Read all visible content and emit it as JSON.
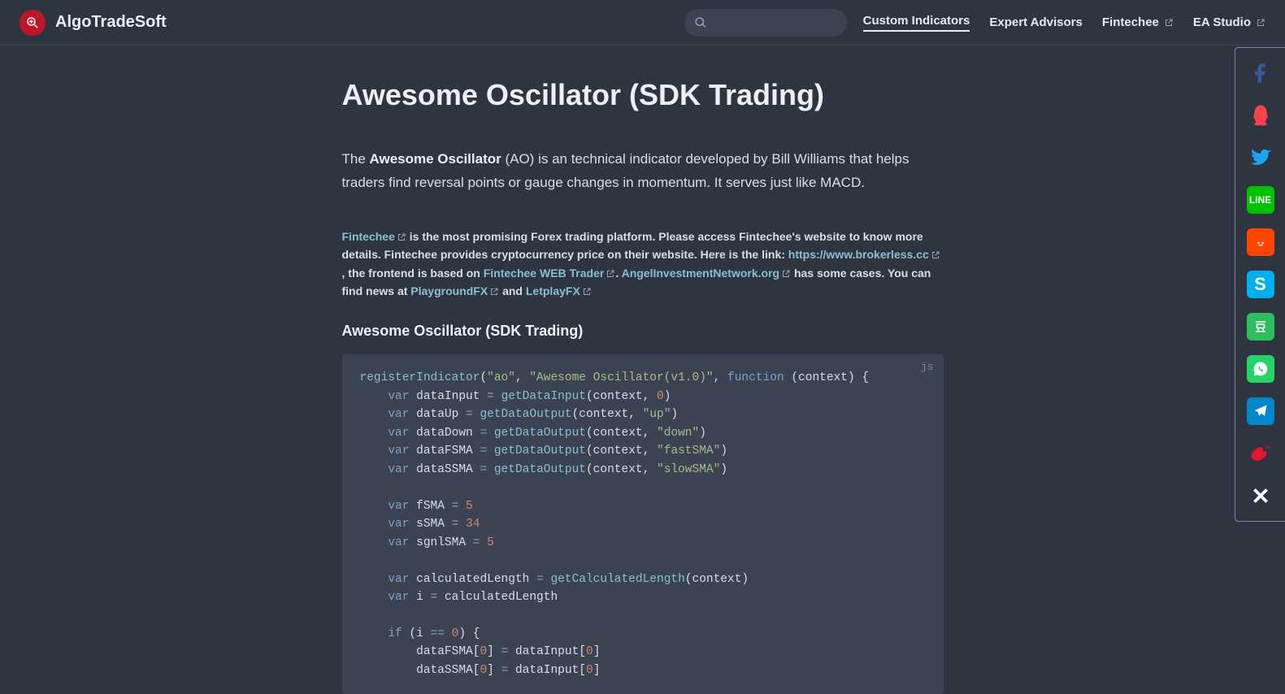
{
  "brand": "AlgoTradeSoft",
  "nav": {
    "ci": "Custom Indicators",
    "ea": "Expert Advisors",
    "fin": "Fintechee",
    "studio": "EA Studio"
  },
  "page": {
    "title": "Awesome Oscillator (SDK Trading)",
    "intro": {
      "pre": "The ",
      "bold": "Awesome Oscillator",
      "post": " (AO) is an technical indicator developed by Bill Williams that helps traders find reversal points or gauge changes in momentum. It serves just like MACD."
    },
    "promo": {
      "fin": "Fintechee",
      "t1": " is the most promising Forex trading platform. Please access Fintechee's website to know more details. Fintechee provides cryptocurrency price on their website. Here is the link: ",
      "brokerless": "https://www.brokerless.cc",
      "t2": ", the frontend is based on ",
      "webtrader": "Fintechee WEB Trader",
      "t3": ". ",
      "angel": "AngelInvestmentNetwork.org",
      "t4": " has some cases. You can find news at ",
      "pg": "PlaygroundFX",
      "and": " and ",
      "let": "LetplayFX"
    },
    "subhead": "Awesome Oscillator (SDK Trading)",
    "code_lang": "js"
  },
  "social": [
    {
      "name": "facebook",
      "color": "#3b5998",
      "bg": "",
      "glyph": "f"
    },
    {
      "name": "qq",
      "color": "#ff414d"
    },
    {
      "name": "twitter",
      "color": "#1da1f2"
    },
    {
      "name": "line",
      "color": "#00c300"
    },
    {
      "name": "reddit",
      "color": "#ff4500"
    },
    {
      "name": "skype",
      "color": "#00aff0"
    },
    {
      "name": "douban",
      "color": "#2dbe60"
    },
    {
      "name": "whatsapp",
      "color": "#25d366"
    },
    {
      "name": "telegram",
      "color": "#0088cc"
    },
    {
      "name": "weibo",
      "color": "#e6162d"
    },
    {
      "name": "close",
      "color": "#ffffff"
    }
  ]
}
